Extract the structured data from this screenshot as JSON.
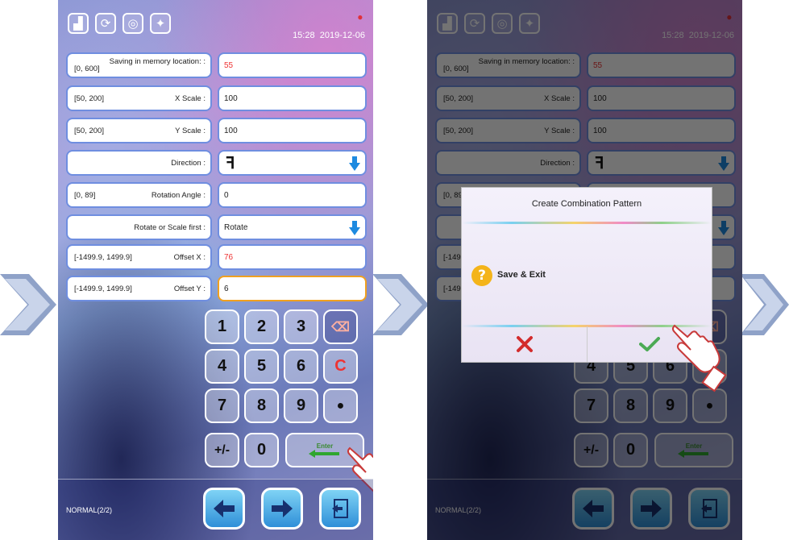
{
  "toolbar": {
    "icons": [
      "square-icon",
      "refresh-icon",
      "rotate-icon",
      "bulb-icon"
    ],
    "brand_left": "",
    "brand_right": "",
    "time": "15:28",
    "date": "2019-12-06"
  },
  "form": {
    "rows": [
      {
        "range": "[0, 600]",
        "label": "Saving in memory location: :",
        "value": "55",
        "value_red": true
      },
      {
        "range": "[50, 200]",
        "label": "X Scale :",
        "value": "100"
      },
      {
        "range": "[50, 200]",
        "label": "Y Scale :",
        "value": "100"
      },
      {
        "range": "",
        "label": "Direction :",
        "value": "ꟻ",
        "dropdown": true
      },
      {
        "range": "[0, 89]",
        "label": "Rotation Angle :",
        "value": "0"
      },
      {
        "range": "",
        "label": "Rotate or Scale first :",
        "value": "Rotate",
        "dropdown": true
      },
      {
        "range": "[-1499.9, 1499.9]",
        "label": "Offset X :",
        "value": "76",
        "value_red": true
      },
      {
        "range": "[-1499.9, 1499.9]",
        "label": "Offset Y :",
        "value": "6"
      }
    ]
  },
  "keypad": {
    "keys": [
      "1",
      "2",
      "3",
      "⌫",
      "4",
      "5",
      "6",
      "C",
      "7",
      "8",
      "9",
      "●",
      "+/-",
      "0",
      "Enter"
    ]
  },
  "footer": {
    "mode": "NORMAL(2/2)"
  },
  "dialog": {
    "title": "Create Combination Pattern",
    "message": "Save & Exit",
    "cancel_icon": "x-icon",
    "confirm_icon": "check-icon"
  },
  "colors": {
    "accent": "#2f8fd8",
    "danger": "#e33333",
    "confirm": "#4caa55",
    "active_border": "#f0a020"
  }
}
